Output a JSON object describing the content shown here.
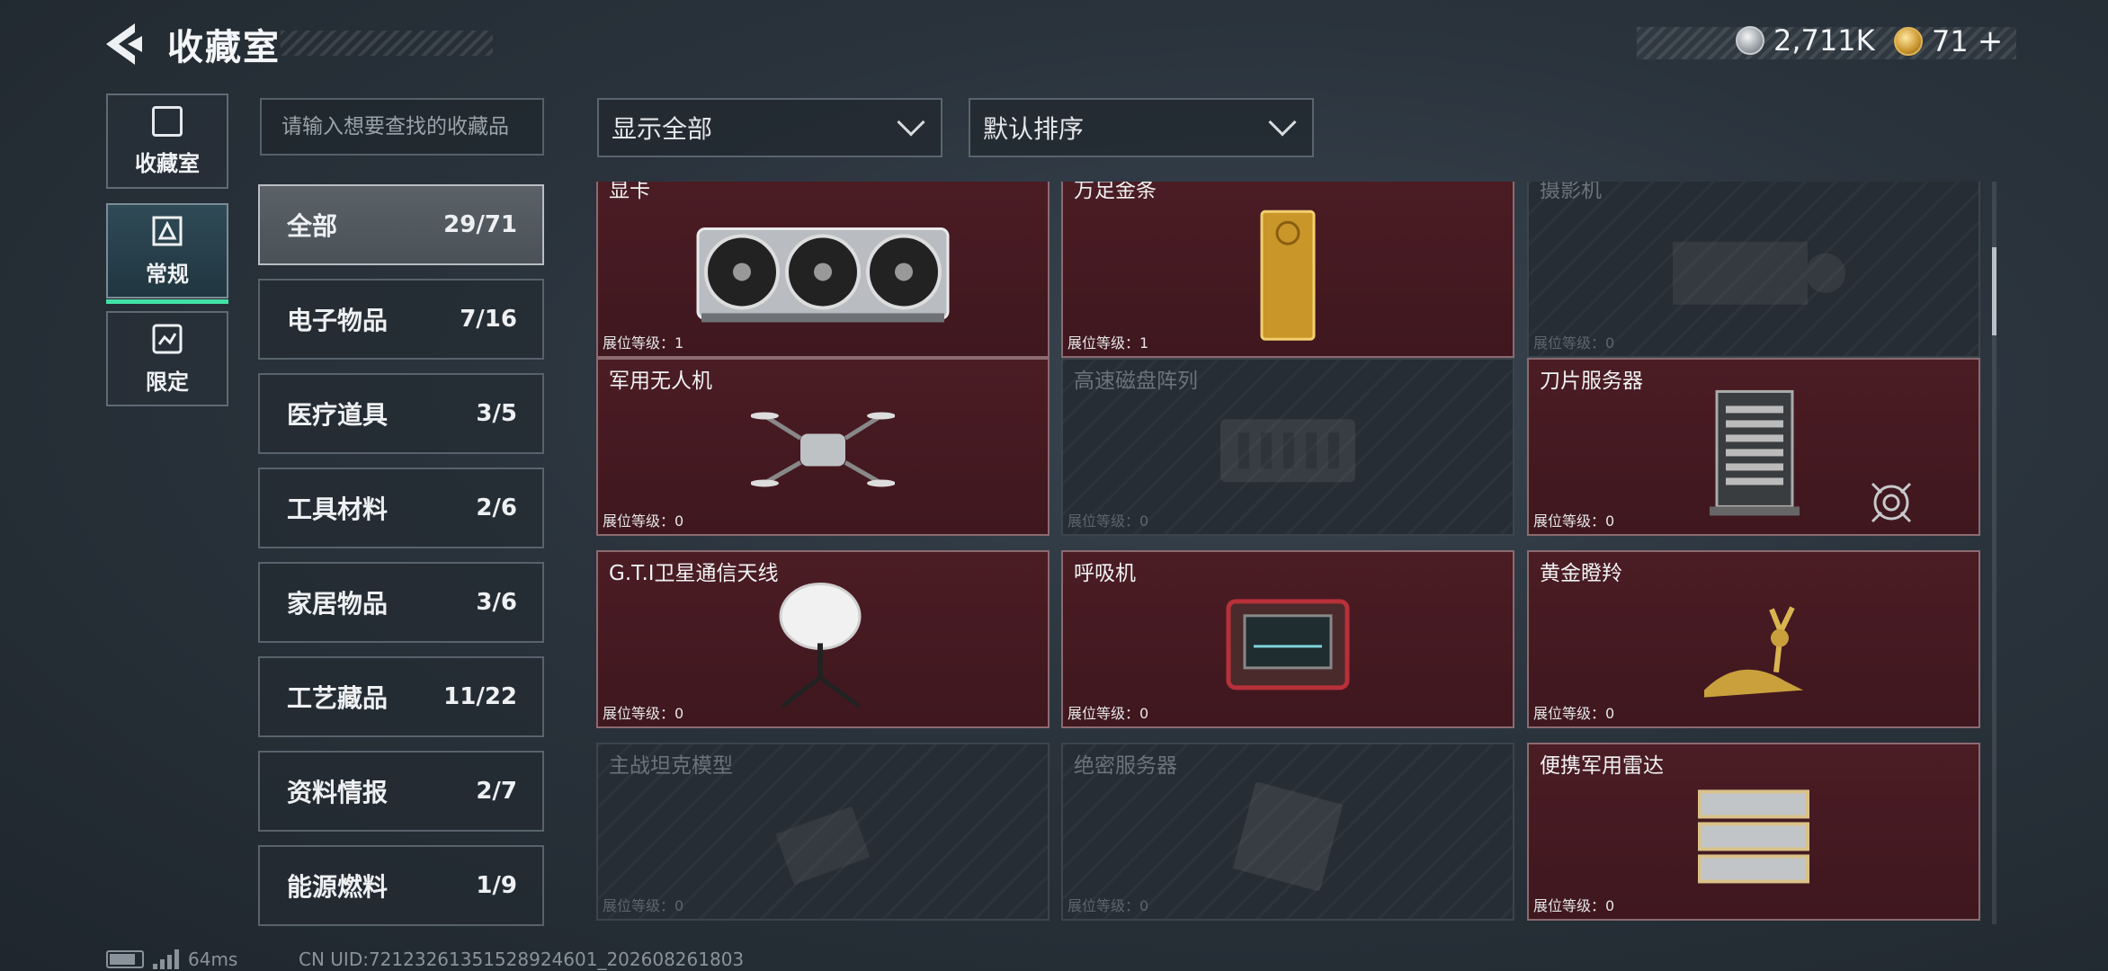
{
  "header": {
    "title": "收藏室",
    "currency_silver": "2,711K",
    "currency_gold": "71",
    "currency_gold_plus": "+"
  },
  "rail": [
    {
      "label": "收藏室",
      "icon": "collection-room-icon"
    },
    {
      "label": "常规",
      "icon": "regular-icon",
      "active": true
    },
    {
      "label": "限定",
      "icon": "limited-icon"
    }
  ],
  "search": {
    "placeholder": "请输入想要查找的收藏品"
  },
  "filters": {
    "display": "显示全部",
    "sort": "默认排序"
  },
  "categories": [
    {
      "name": "全部",
      "count": "29/71",
      "active": true
    },
    {
      "name": "电子物品",
      "count": "7/16"
    },
    {
      "name": "医疗道具",
      "count": "3/5"
    },
    {
      "name": "工具材料",
      "count": "2/6"
    },
    {
      "name": "家居物品",
      "count": "3/6"
    },
    {
      "name": "工艺藏品",
      "count": "11/22"
    },
    {
      "name": "资料情报",
      "count": "2/7"
    },
    {
      "name": "能源燃料",
      "count": "1/9"
    }
  ],
  "level_label": "展位等级：",
  "items": [
    {
      "name": "显卡",
      "level": "1",
      "locked": false,
      "art": "gpu"
    },
    {
      "name": "万足金条",
      "level": "1",
      "locked": false,
      "art": "goldbar"
    },
    {
      "name": "摄影机",
      "level": "0",
      "locked": true,
      "art": "camera"
    },
    {
      "name": "军用无人机",
      "level": "0",
      "locked": false,
      "art": "drone"
    },
    {
      "name": "高速磁盘阵列",
      "level": "0",
      "locked": true,
      "art": "disk"
    },
    {
      "name": "刀片服务器",
      "level": "0",
      "locked": false,
      "art": "server"
    },
    {
      "name": "G.T.I卫星通信天线",
      "level": "0",
      "locked": false,
      "art": "antenna"
    },
    {
      "name": "呼吸机",
      "level": "0",
      "locked": false,
      "art": "ventilator"
    },
    {
      "name": "黄金瞪羚",
      "level": "0",
      "locked": false,
      "art": "gazelle"
    },
    {
      "name": "主战坦克模型",
      "level": "0",
      "locked": true,
      "art": "tank"
    },
    {
      "name": "绝密服务器",
      "level": "0",
      "locked": true,
      "art": "secret-server"
    },
    {
      "name": "便携军用雷达",
      "level": "0",
      "locked": false,
      "art": "radar"
    }
  ],
  "footer": {
    "ping": "64ms",
    "uid": "CN UID:72123261351528924601_202608261803"
  }
}
